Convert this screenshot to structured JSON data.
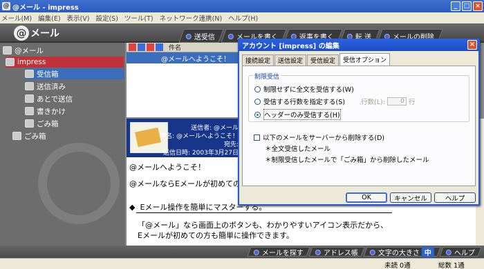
{
  "window": {
    "title": "@メール - impress",
    "min": "_",
    "max": "□",
    "close": "×"
  },
  "menu": [
    "メール(M)",
    "編集(E)",
    "表示(V)",
    "設定(S)",
    "ツール(T)",
    "ネットワーク連携(N)",
    "ヘルプ(H)"
  ],
  "logo": {
    "at": "@",
    "text": "メール"
  },
  "toolbar": [
    "送受信",
    "メールを書く",
    "返事を書く",
    "転 送",
    "メールの削除"
  ],
  "tree": {
    "root": "@メール",
    "account": "impress",
    "inbox": "受信箱",
    "sent": "送信済み",
    "later": "あとで送信",
    "draft": "書きかけ",
    "trash_sub": "ごみ箱",
    "trash": "ごみ箱"
  },
  "list": {
    "header_col": "件名",
    "row_subject": "@メールへようこそ！"
  },
  "preview": {
    "from": "送信者: @メール",
    "subject": "件名: @メールへようこそ！",
    "to": "宛先:",
    "date": "送信日時: 2003年3月27日"
  },
  "body": {
    "line1": "@メールへようこそ！",
    "line2": "@メールならEメールが初めての",
    "line3": "Eメール操作を簡単にマスターする。",
    "line4": "「@メール」なら画面上のボタンも、わかりやすいアイコン表示だから、",
    "line5": "Eメールが初めての方も簡単に操作できます。",
    "bullet": "◆"
  },
  "bottom": {
    "search": "メールを探す",
    "address": "アドレス帳",
    "fontsize": "文字の大きさ",
    "fontsize_value": "中",
    "help": "ヘルプ"
  },
  "status": {
    "unread": "未読 0通",
    "total": "総数 1通"
  },
  "dialog": {
    "title": "アカウント [impress] の編集",
    "close": "×",
    "tabs": [
      "接続設定",
      "送信設定",
      "受信設定",
      "受信オプション"
    ],
    "group_label": "制限受信",
    "opt_no_limit": "制限せずに全文を受信する(W)",
    "opt_lines": "受信する行数を指定する(S)",
    "lines_label": "行数(L):",
    "lines_value": "0",
    "lines_unit": "行",
    "opt_header": "ヘッダーのみ受信する(H)",
    "delete_chk": "以下のメールをサーバーから削除する(D)",
    "delete_note1": "＊全文受信したメール",
    "delete_note2": "＊制限受信したメールで「ごみ箱」から削除したメール",
    "ok": "OK",
    "cancel": "キャンセル",
    "help": "ヘルプ"
  }
}
